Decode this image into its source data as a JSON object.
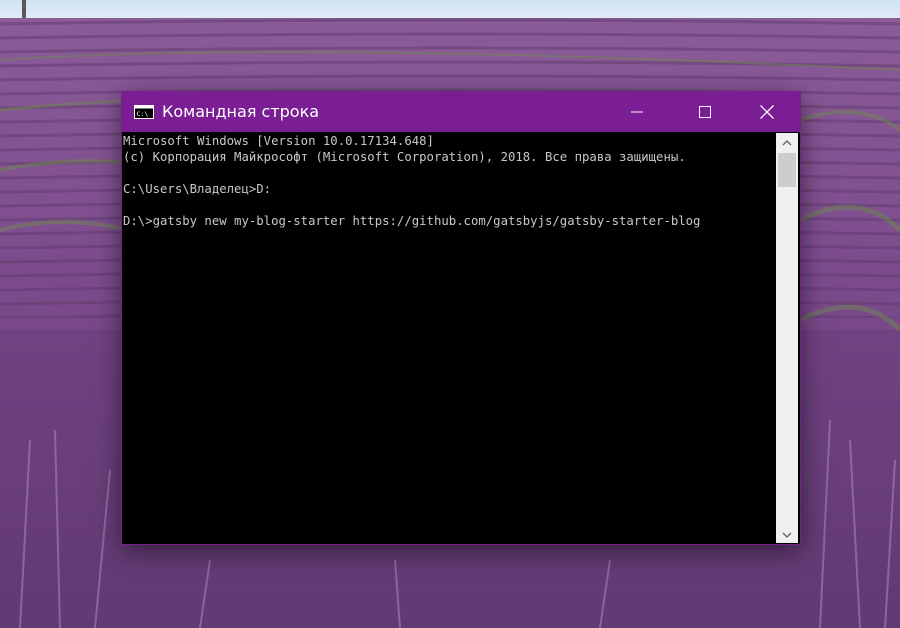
{
  "desktop": {
    "wallpaper": "lavender-field-icon"
  },
  "window": {
    "title": "Командная строка",
    "icon": "cmd-icon",
    "accent_color": "#7b1e94",
    "controls": {
      "minimize": "minimize-icon",
      "maximize": "maximize-icon",
      "close": "close-icon"
    }
  },
  "console": {
    "background": "#000000",
    "text_color": "#c8c8c8",
    "lines": [
      "Microsoft Windows [Version 10.0.17134.648]",
      "(c) Корпорация Майкрософт (Microsoft Corporation), 2018. Все права защищены.",
      "",
      "C:\\Users\\Владелец>D:",
      "",
      "D:\\>gatsby new my-blog-starter https://github.com/gatsbyjs/gatsby-starter-blog"
    ]
  },
  "scrollbar": {
    "up_icon": "chevron-up-icon",
    "down_icon": "chevron-down-icon"
  }
}
